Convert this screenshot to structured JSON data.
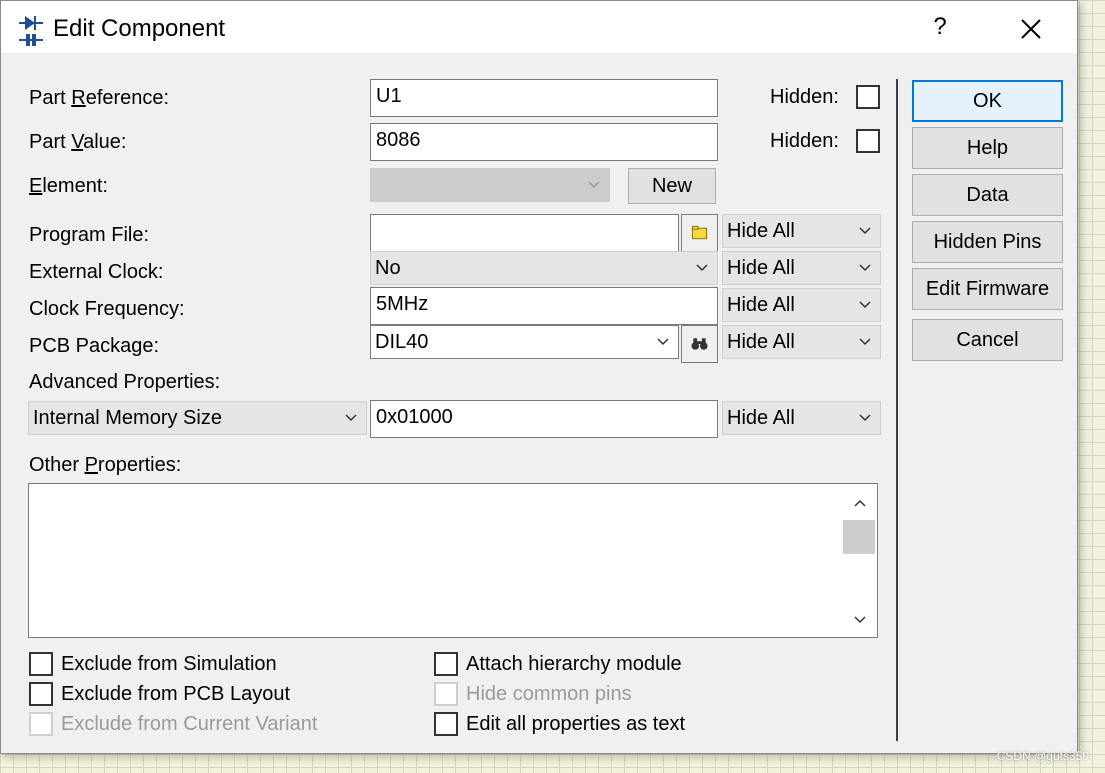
{
  "window": {
    "title": "Edit Component",
    "help_glyph": "?"
  },
  "fields": {
    "part_reference": {
      "label_pre": "Part ",
      "label_key": "R",
      "label_post": "eference:",
      "value": "U1",
      "hidden_label": "Hidden:"
    },
    "part_value": {
      "label_pre": "Part ",
      "label_key": "V",
      "label_post": "alue:",
      "value": "8086",
      "hidden_label": "Hidden:"
    },
    "element": {
      "label_key": "E",
      "label_post": "lement:",
      "value": "",
      "new_label": "New"
    },
    "program_file": {
      "label": "Program File:",
      "value": "",
      "visibility": "Hide All"
    },
    "external_clock": {
      "label": "External Clock:",
      "value": "No",
      "visibility": "Hide All"
    },
    "clock_frequency": {
      "label": "Clock Frequency:",
      "value": "5MHz",
      "visibility": "Hide All"
    },
    "pcb_package": {
      "label": "PCB Package:",
      "value": "DIL40",
      "visibility": "Hide All"
    },
    "advanced": {
      "label": "Advanced Properties:",
      "property": "Internal Memory Size",
      "value": "0x01000",
      "visibility": "Hide All"
    },
    "other": {
      "label_pre": "Other ",
      "label_key": "P",
      "label_post": "roperties:",
      "value": ""
    }
  },
  "options": {
    "exclude_simulation": "Exclude from Simulation",
    "exclude_pcb": "Exclude from PCB Layout",
    "exclude_variant": "Exclude from Current Variant",
    "attach_hierarchy": "Attach hierarchy module",
    "hide_common_pins": "Hide common pins",
    "edit_as_text": "Edit all properties as text"
  },
  "buttons": {
    "ok": "OK",
    "help": "Help",
    "data": "Data",
    "hidden_pins": "Hidden Pins",
    "edit_firmware": "Edit Firmware",
    "cancel": "Cancel"
  },
  "watermark": "CSDN @guts350",
  "colors": {
    "dialog_bg": "#f0f0f0",
    "grid_bg": "#f2f1dc",
    "default_button_border": "#0078d7"
  }
}
